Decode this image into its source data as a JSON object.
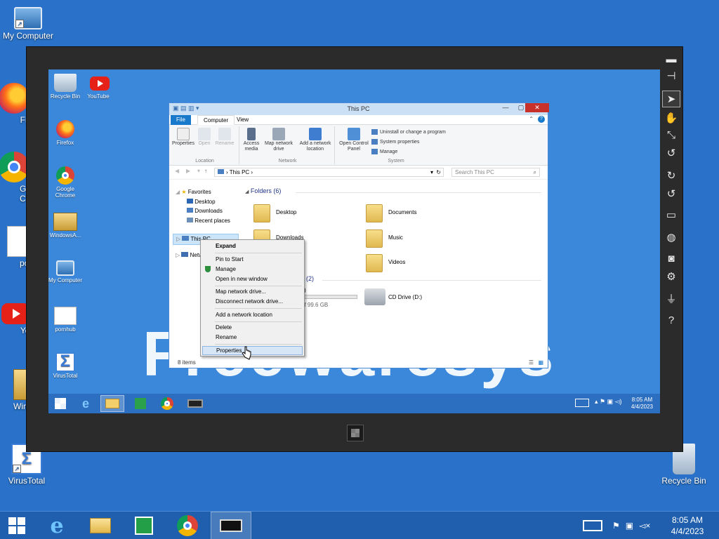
{
  "desktop": {
    "icons": [
      {
        "label": "My Computer"
      },
      {
        "label": "Fire"
      },
      {
        "label": "Goo Chro"
      },
      {
        "label": "porn"
      },
      {
        "label": "You"
      },
      {
        "label": "Windo"
      },
      {
        "label": "VirusTotal"
      },
      {
        "label": "Recycle Bin"
      }
    ]
  },
  "taskbar": {
    "clock_time": "8:05 AM",
    "clock_date": "4/4/2023"
  },
  "viewer": {
    "side_buttons": [
      "minimize",
      "pin",
      "pointer",
      "hand",
      "shrink",
      "recycle",
      "rotate-cw",
      "rotate-ccw",
      "monitor",
      "globe",
      "camera",
      "settings",
      "usb",
      "help"
    ]
  },
  "inner": {
    "brand_text": "Freewaresys",
    "icons": [
      {
        "label": "Recycle Bin"
      },
      {
        "label": "YouTube"
      },
      {
        "label": "Firefox"
      },
      {
        "label": "Google Chrome"
      },
      {
        "label": "WindowsA..."
      },
      {
        "label": "My Computer"
      },
      {
        "label": "pornhub"
      },
      {
        "label": "VirusTotal"
      }
    ],
    "taskbar": {
      "clock_time": "8:05 AM",
      "clock_date": "4/4/2023"
    }
  },
  "explorer": {
    "title": "This PC",
    "tabs": {
      "file": "File",
      "computer": "Computer",
      "view": "View"
    },
    "ribbon": {
      "location": {
        "name": "Location",
        "properties": "Properties",
        "open": "Open",
        "rename": "Rename"
      },
      "network": {
        "name": "Network",
        "access_media": "Access media",
        "map_drive": "Map network drive",
        "add_location": "Add a network location"
      },
      "system": {
        "name": "System",
        "control_panel": "Open Control Panel",
        "uninstall": "Uninstall or change a program",
        "sys_props": "System properties",
        "manage": "Manage"
      }
    },
    "address": {
      "path": "This PC",
      "search_placeholder": "Search This PC"
    },
    "nav": {
      "favorites": "Favorites",
      "desktop": "Desktop",
      "downloads": "Downloads",
      "recent": "Recent places",
      "this_pc": "This PC",
      "network": "Network"
    },
    "folders_header": "Folders (6)",
    "folders": [
      "Desktop",
      "Documents",
      "Downloads",
      "Music",
      "Videos"
    ],
    "devices_header": "s (2)",
    "drive_c_size": "of 99.6 GB",
    "drive_c_label": "s)",
    "drive_d": "CD Drive (D:)",
    "status": "8 items"
  },
  "context_menu": {
    "items": [
      "Expand",
      "Pin to Start",
      "Manage",
      "Open in new window",
      "Map network drive...",
      "Disconnect network drive...",
      "Add a network location",
      "Delete",
      "Rename",
      "Properties"
    ]
  }
}
